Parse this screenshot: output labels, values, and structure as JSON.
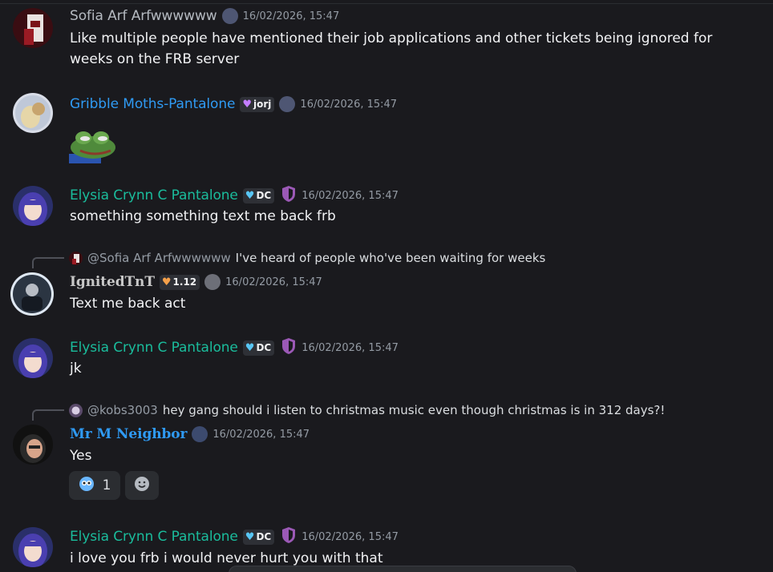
{
  "messages": [
    {
      "username": "Sofia Arf Arfwwwwww",
      "username_color": "#b5bac1",
      "timestamp": "16/02/2026, 15:47",
      "text": "Like multiple people have mentioned their job applications and other tickets being ignored for weeks on the FRB server"
    },
    {
      "username": "Gribble Moths-Pantalone",
      "username_color": "#2f9af3",
      "tag": "jorj",
      "timestamp": "16/02/2026, 15:47",
      "sticker": "pepe-frog-emoji"
    },
    {
      "username": "Elysia Crynn C Pantalone",
      "username_color": "#1abc9c",
      "tag": "DC",
      "timestamp": "16/02/2026, 15:47",
      "text": "something something text me back frb"
    },
    {
      "reply_to": "@Sofia Arf Arfwwwwww",
      "reply_text": "I've heard of people who've been waiting for weeks",
      "username": "IgnitedTnT",
      "username_color": "#c8c8c8",
      "tag": "1.12",
      "timestamp": "16/02/2026, 15:47",
      "text": "Text me back act"
    },
    {
      "username": "Elysia Crynn C Pantalone",
      "username_color": "#1abc9c",
      "tag": "DC",
      "timestamp": "16/02/2026, 15:47",
      "text": "jk"
    },
    {
      "reply_to": "@kobs3003",
      "reply_text": "hey gang should i listen to christmas music even though christmas is in 312 days?!",
      "username": "Mr M Neighbor",
      "username_color": "#2f9af3",
      "timestamp": "16/02/2026, 15:47",
      "text": "Yes",
      "reaction": {
        "emoji": "pleading-face-emoji",
        "count": "1"
      }
    },
    {
      "username": "Elysia Crynn C Pantalone",
      "username_color": "#1abc9c",
      "tag": "DC",
      "timestamp": "16/02/2026, 15:47",
      "text": "i love you frb i would never hurt you with that"
    }
  ]
}
